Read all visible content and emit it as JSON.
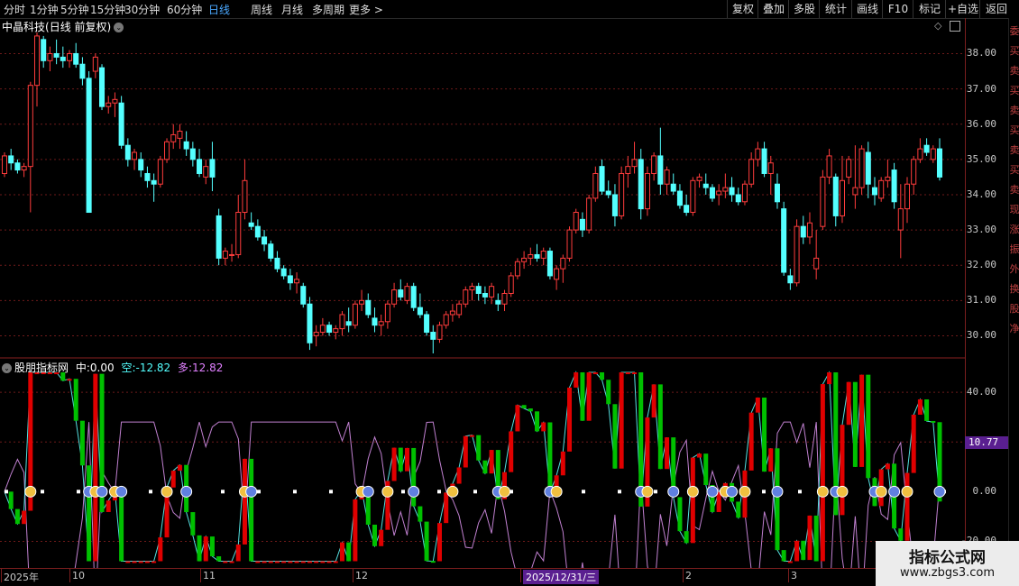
{
  "toolbar": {
    "timeframes": [
      "分时",
      "1分钟",
      "5分钟",
      "15分钟",
      "30分钟",
      "60分钟",
      "日线",
      "周线",
      "月线",
      "多周期",
      "更多 >"
    ],
    "active": "日线",
    "tools": [
      "复权",
      "叠加",
      "多股",
      "统计",
      "画线",
      "F10",
      "标记",
      "+自选",
      "返回"
    ]
  },
  "main_chart": {
    "stock_name": "中晶科技",
    "mode": "(日线 前复权)",
    "y_ticks": [
      "38.00",
      "37.00",
      "36.00",
      "35.00",
      "34.00",
      "33.00",
      "32.00",
      "31.00",
      "30.00"
    ]
  },
  "indicator": {
    "name": "股朋指标网",
    "mid_label": "中:",
    "mid_value": "0.00",
    "short_label": "空:",
    "short_value": "-12.82",
    "long_label": "多:",
    "long_value": "12.82",
    "y_ticks": [
      "40.00",
      "20.00",
      "0.00",
      "-20.00"
    ],
    "current_badge": "10.77"
  },
  "x_axis": {
    "labels": [
      "2025年",
      "10",
      "11",
      "12",
      "2025/12/31/三",
      "2",
      "3"
    ],
    "highlight": "2025/12/31/三"
  },
  "right_strip": [
    "委",
    "买",
    "卖",
    "买",
    "卖",
    "买",
    "卖",
    "买",
    "卖",
    "现",
    "涨",
    "振",
    "外",
    "换",
    "股",
    "净"
  ],
  "watermark": {
    "title": "指标公式网",
    "url": "www.zbgs3.com"
  },
  "colors": {
    "up": "#ff3c3c",
    "down": "#54ffff",
    "bull": "#00c000",
    "bear": "#e00000",
    "grid": "#6e1a1a"
  },
  "chart_data": {
    "type": "candlestick",
    "title": "中晶科技(日线 前复权)",
    "ylim": [
      29.5,
      38.6
    ],
    "ohlc": [
      [
        34.6,
        35.2,
        34.5,
        35.1
      ],
      [
        35.1,
        35.3,
        34.7,
        34.9
      ],
      [
        34.9,
        35.0,
        34.6,
        34.7
      ],
      [
        34.7,
        34.9,
        34.5,
        34.8
      ],
      [
        34.8,
        37.2,
        33.5,
        37.1
      ],
      [
        37.1,
        38.6,
        36.5,
        38.5
      ],
      [
        38.4,
        38.5,
        37.6,
        37.8
      ],
      [
        37.8,
        38.2,
        37.5,
        38.0
      ],
      [
        38.0,
        38.4,
        37.7,
        37.9
      ],
      [
        37.9,
        38.2,
        37.6,
        37.8
      ],
      [
        37.8,
        38.1,
        37.6,
        38.0
      ],
      [
        38.0,
        38.3,
        37.6,
        37.7
      ],
      [
        37.7,
        37.9,
        37.1,
        37.3
      ],
      [
        37.3,
        37.5,
        33.5,
        33.5
      ],
      [
        37.5,
        38.0,
        37.3,
        37.9
      ],
      [
        37.6,
        37.7,
        36.4,
        36.5
      ],
      [
        36.5,
        36.8,
        36.3,
        36.6
      ],
      [
        36.6,
        36.9,
        36.2,
        36.7
      ],
      [
        36.6,
        36.8,
        35.3,
        35.4
      ],
      [
        35.4,
        35.6,
        34.8,
        35.0
      ],
      [
        35.0,
        35.3,
        34.7,
        35.2
      ],
      [
        35.0,
        35.2,
        34.5,
        34.7
      ],
      [
        34.6,
        34.8,
        34.2,
        34.4
      ],
      [
        34.4,
        34.6,
        33.8,
        34.3
      ],
      [
        34.3,
        35.1,
        34.2,
        35.0
      ],
      [
        35.0,
        35.6,
        34.9,
        35.5
      ],
      [
        35.5,
        36.0,
        35.3,
        35.7
      ],
      [
        35.6,
        36.0,
        35.3,
        35.8
      ],
      [
        35.5,
        35.8,
        35.1,
        35.3
      ],
      [
        35.3,
        35.5,
        34.8,
        35.0
      ],
      [
        35.0,
        35.3,
        34.5,
        34.6
      ],
      [
        34.5,
        35.0,
        34.3,
        34.8
      ],
      [
        35.0,
        35.5,
        34.1,
        34.5
      ],
      [
        33.4,
        33.6,
        32.0,
        32.2
      ],
      [
        32.2,
        32.5,
        32.0,
        32.4
      ],
      [
        32.3,
        32.6,
        32.1,
        32.3
      ],
      [
        32.3,
        34.0,
        32.2,
        33.5
      ],
      [
        33.5,
        35.0,
        33.3,
        34.4
      ],
      [
        33.2,
        33.5,
        33.0,
        33.1
      ],
      [
        33.1,
        33.3,
        32.7,
        32.8
      ],
      [
        32.8,
        33.0,
        32.4,
        32.6
      ],
      [
        32.6,
        32.7,
        32.1,
        32.2
      ],
      [
        32.2,
        32.4,
        31.8,
        31.9
      ],
      [
        31.9,
        32.0,
        31.6,
        31.7
      ],
      [
        31.7,
        31.9,
        31.3,
        31.5
      ],
      [
        31.5,
        31.8,
        31.2,
        31.6
      ],
      [
        31.4,
        31.5,
        30.8,
        30.9
      ],
      [
        30.9,
        31.1,
        29.6,
        29.8
      ],
      [
        30.0,
        30.3,
        29.7,
        30.1
      ],
      [
        30.1,
        30.5,
        30.0,
        30.3
      ],
      [
        30.3,
        30.4,
        30.0,
        30.1
      ],
      [
        30.1,
        30.3,
        29.9,
        30.2
      ],
      [
        30.2,
        30.7,
        30.0,
        30.6
      ],
      [
        30.4,
        30.8,
        30.1,
        30.3
      ],
      [
        30.3,
        31.0,
        30.2,
        30.9
      ],
      [
        30.9,
        31.3,
        30.7,
        31.0
      ],
      [
        31.0,
        31.2,
        30.5,
        30.6
      ],
      [
        30.5,
        30.8,
        30.1,
        30.3
      ],
      [
        30.3,
        30.6,
        30.0,
        30.4
      ],
      [
        30.4,
        31.0,
        30.2,
        30.9
      ],
      [
        30.9,
        31.5,
        30.8,
        31.3
      ],
      [
        31.3,
        31.6,
        31.0,
        31.1
      ],
      [
        31.0,
        31.5,
        30.9,
        31.4
      ],
      [
        31.4,
        31.5,
        30.7,
        30.8
      ],
      [
        30.8,
        31.2,
        30.5,
        30.6
      ],
      [
        30.6,
        30.7,
        30.0,
        30.1
      ],
      [
        30.1,
        30.3,
        29.5,
        29.9
      ],
      [
        29.9,
        30.4,
        29.8,
        30.3
      ],
      [
        30.3,
        30.7,
        30.2,
        30.6
      ],
      [
        30.6,
        30.9,
        30.4,
        30.7
      ],
      [
        30.6,
        31.0,
        30.5,
        30.9
      ],
      [
        30.9,
        31.4,
        30.8,
        31.3
      ],
      [
        31.3,
        31.5,
        31.0,
        31.4
      ],
      [
        31.4,
        31.5,
        31.0,
        31.2
      ],
      [
        31.2,
        31.4,
        30.9,
        31.1
      ],
      [
        31.1,
        31.5,
        30.9,
        31.4
      ],
      [
        31.0,
        31.2,
        30.7,
        30.9
      ],
      [
        30.9,
        31.3,
        30.7,
        31.2
      ],
      [
        31.2,
        31.8,
        31.1,
        31.7
      ],
      [
        31.7,
        32.2,
        31.6,
        32.1
      ],
      [
        32.1,
        32.4,
        31.9,
        32.2
      ],
      [
        32.2,
        32.5,
        32.0,
        32.3
      ],
      [
        32.3,
        32.6,
        32.1,
        32.2
      ],
      [
        32.2,
        32.5,
        32.0,
        32.4
      ],
      [
        32.4,
        32.5,
        31.6,
        31.7
      ],
      [
        31.6,
        32.0,
        31.3,
        31.9
      ],
      [
        31.9,
        32.3,
        31.5,
        32.2
      ],
      [
        32.2,
        33.1,
        32.1,
        33.0
      ],
      [
        33.0,
        33.6,
        32.9,
        33.5
      ],
      [
        33.3,
        33.5,
        32.8,
        33.0
      ],
      [
        33.0,
        34.0,
        32.9,
        33.9
      ],
      [
        33.9,
        34.8,
        33.8,
        34.6
      ],
      [
        34.8,
        35.0,
        34.0,
        34.1
      ],
      [
        34.1,
        34.4,
        33.9,
        34.0
      ],
      [
        34.0,
        34.3,
        33.1,
        33.4
      ],
      [
        33.4,
        34.8,
        33.3,
        34.6
      ],
      [
        34.6,
        35.1,
        34.2,
        34.8
      ],
      [
        34.8,
        35.5,
        34.6,
        35.0
      ],
      [
        35.0,
        35.3,
        33.3,
        33.6
      ],
      [
        33.6,
        34.8,
        33.4,
        34.6
      ],
      [
        34.6,
        35.2,
        34.4,
        35.1
      ],
      [
        35.1,
        35.9,
        34.0,
        34.3
      ],
      [
        34.3,
        34.8,
        34.0,
        34.7
      ],
      [
        34.3,
        34.6,
        34.0,
        34.1
      ],
      [
        34.1,
        34.3,
        33.6,
        33.7
      ],
      [
        33.7,
        34.0,
        33.4,
        33.5
      ],
      [
        33.5,
        34.5,
        33.4,
        34.4
      ],
      [
        34.4,
        34.6,
        34.2,
        34.5
      ],
      [
        34.3,
        34.6,
        34.0,
        34.2
      ],
      [
        34.2,
        34.3,
        33.8,
        33.9
      ],
      [
        34.0,
        34.3,
        33.7,
        34.1
      ],
      [
        34.1,
        34.6,
        33.9,
        34.2
      ],
      [
        34.2,
        34.5,
        33.8,
        34.0
      ],
      [
        34.0,
        34.2,
        33.7,
        33.8
      ],
      [
        33.8,
        34.4,
        33.7,
        34.3
      ],
      [
        34.3,
        35.2,
        34.2,
        35.0
      ],
      [
        35.0,
        35.5,
        34.8,
        35.3
      ],
      [
        35.3,
        35.5,
        34.5,
        34.6
      ],
      [
        34.6,
        35.1,
        34.0,
        34.9
      ],
      [
        34.3,
        34.6,
        33.6,
        33.8
      ],
      [
        33.6,
        33.8,
        31.7,
        31.8
      ],
      [
        31.7,
        31.9,
        31.3,
        31.5
      ],
      [
        31.5,
        33.3,
        31.4,
        33.1
      ],
      [
        33.1,
        33.4,
        32.6,
        32.8
      ],
      [
        32.8,
        33.5,
        32.6,
        33.2
      ],
      [
        31.9,
        33.0,
        31.6,
        32.2
      ],
      [
        33.1,
        34.7,
        33.0,
        34.5
      ],
      [
        34.5,
        35.3,
        34.3,
        35.1
      ],
      [
        34.5,
        34.6,
        33.1,
        33.4
      ],
      [
        33.4,
        35.1,
        33.2,
        34.4
      ],
      [
        34.5,
        35.1,
        34.3,
        35.0
      ],
      [
        34.0,
        35.4,
        33.6,
        34.2
      ],
      [
        34.2,
        35.4,
        34.0,
        35.3
      ],
      [
        35.2,
        35.5,
        33.9,
        34.3
      ],
      [
        34.2,
        34.5,
        33.7,
        34.0
      ],
      [
        33.9,
        34.5,
        33.8,
        34.4
      ],
      [
        34.4,
        35.0,
        34.2,
        34.5
      ],
      [
        34.7,
        34.9,
        33.6,
        33.8
      ],
      [
        33.0,
        34.3,
        32.2,
        33.6
      ],
      [
        33.6,
        34.5,
        33.2,
        34.3
      ],
      [
        34.3,
        35.1,
        34.0,
        35.0
      ],
      [
        35.0,
        35.6,
        34.9,
        35.3
      ],
      [
        35.4,
        35.6,
        35.1,
        35.2
      ],
      [
        35.0,
        35.4,
        34.9,
        35.3
      ],
      [
        35.3,
        35.6,
        34.4,
        34.5
      ]
    ],
    "indicator_series": [
      {
        "name": "中",
        "value": 0.0
      },
      {
        "name": "空",
        "value": -12.82
      },
      {
        "name": "多",
        "value": 12.82
      }
    ],
    "indicator_ylim": [
      -30,
      52
    ]
  }
}
